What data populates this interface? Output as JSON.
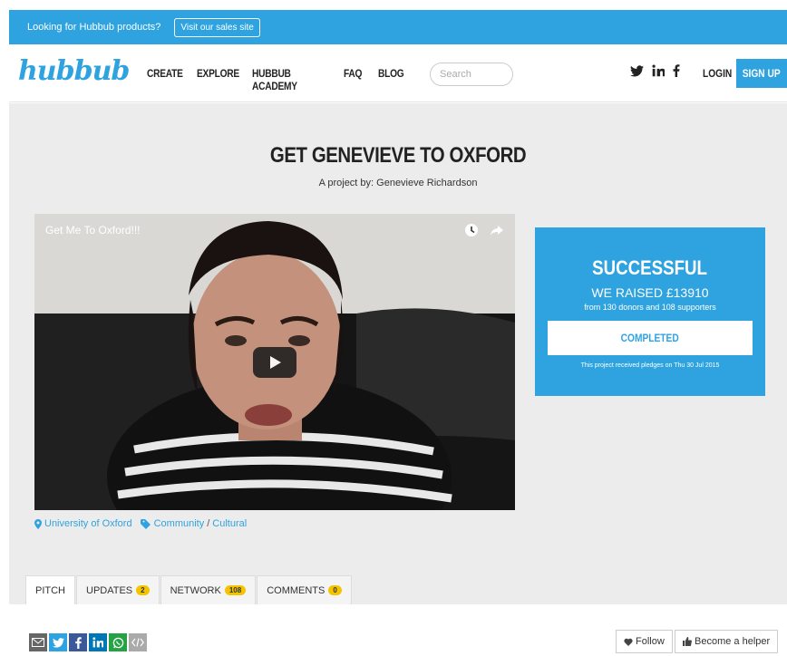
{
  "promo": {
    "text": "Looking for Hubbub products?",
    "button": "Visit our sales site"
  },
  "header": {
    "logo": "hubbub",
    "nav": [
      "CREATE",
      "EXPLORE",
      "HUBBUB ACADEMY",
      "FAQ",
      "BLOG"
    ],
    "search_placeholder": "Search",
    "login": "LOGIN",
    "signup": "SIGN UP"
  },
  "project": {
    "title": "GET GENEVIEVE TO OXFORD",
    "byline": "A project by: Genevieve Richardson",
    "video_title": "Get Me To Oxford!!!",
    "location": "University of Oxford",
    "category": "Community",
    "subcategory": "Cultural"
  },
  "status": {
    "title": "SUCCESSFUL",
    "raised": "WE RAISED £13910",
    "from": "from 130 donors and 108 supporters",
    "button": "COMPLETED",
    "note": "This project received pledges on Thu 30 Jul 2015"
  },
  "tabs": [
    {
      "label": "PITCH",
      "badge": ""
    },
    {
      "label": "UPDATES",
      "badge": "2"
    },
    {
      "label": "NETWORK",
      "badge": "108"
    },
    {
      "label": "COMMENTS",
      "badge": "0"
    }
  ],
  "actions": {
    "follow": "Follow",
    "helper": "Become a helper"
  },
  "colors": {
    "brand": "#2ea3e0",
    "badge": "#f5c400"
  }
}
